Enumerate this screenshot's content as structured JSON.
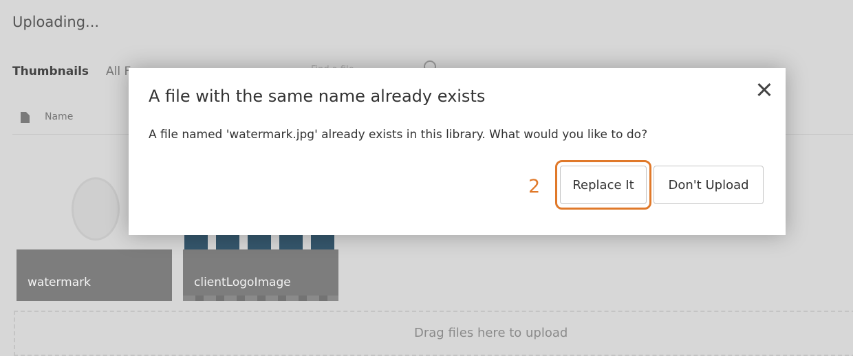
{
  "page": {
    "status": "Uploading...",
    "tabs": [
      "Thumbnails",
      "All F"
    ],
    "filter_placeholder": "Find a file",
    "column_header": "Name",
    "files": [
      {
        "name": "watermark"
      },
      {
        "name": "clientLogoImage"
      }
    ],
    "dropzone_text": "Drag files here to upload"
  },
  "dialog": {
    "title": "A file with the same name already exists",
    "message": "A file named 'watermark.jpg' already exists in this library. What would you like to do?",
    "step_number": "2",
    "replace_label": "Replace It",
    "dont_upload_label": "Don't Upload",
    "close_icon": "close-icon"
  },
  "colors": {
    "accent": "#e0792a",
    "overlay": "#d7d7d7",
    "tile": "#7d7d7d"
  }
}
